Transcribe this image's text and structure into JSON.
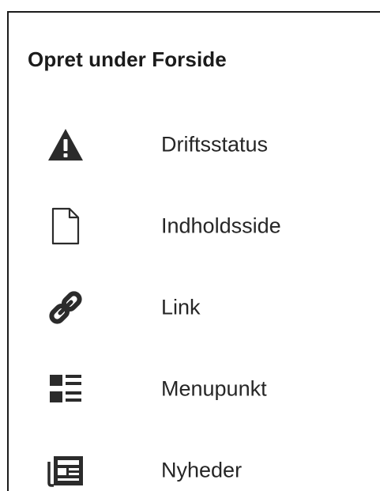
{
  "panel": {
    "title": "Opret under Forside"
  },
  "menu": {
    "items": [
      {
        "label": "Driftsstatus",
        "icon": "warning-icon"
      },
      {
        "label": "Indholdsside",
        "icon": "page-icon"
      },
      {
        "label": "Link",
        "icon": "link-icon"
      },
      {
        "label": "Menupunkt",
        "icon": "list-icon"
      },
      {
        "label": "Nyheder",
        "icon": "newspaper-icon"
      }
    ]
  },
  "colors": {
    "text": "#1b1b1b",
    "icon": "#2b2b2b",
    "border": "#1b1b1b",
    "background": "#ffffff"
  }
}
